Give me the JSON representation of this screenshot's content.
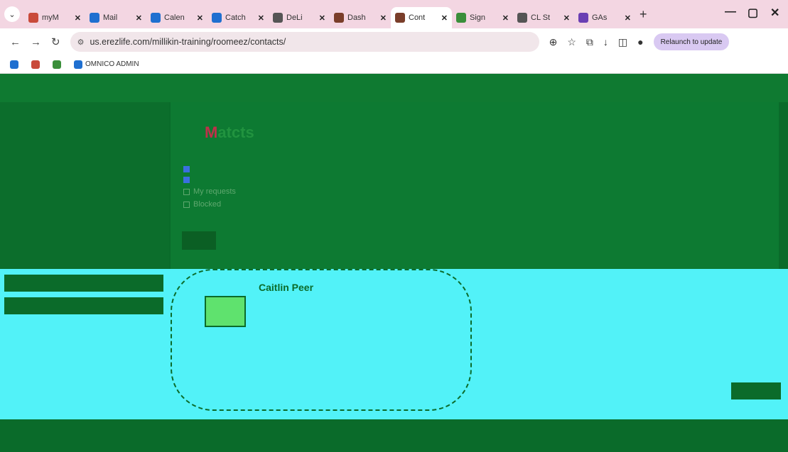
{
  "browser": {
    "tabs": [
      {
        "label": "myM",
        "color": "#c94a3a",
        "active": false
      },
      {
        "label": "Mail",
        "color": "#1f6fd0",
        "active": false
      },
      {
        "label": "Calen",
        "color": "#1f6fd0",
        "active": false
      },
      {
        "label": "Catch",
        "color": "#1f6fd0",
        "active": false
      },
      {
        "label": "DeLi",
        "color": "#555555",
        "active": false
      },
      {
        "label": "Dash",
        "color": "#7a3e2a",
        "active": false
      },
      {
        "label": "Cont",
        "color": "#7a3e2a",
        "active": true
      },
      {
        "label": "Sign",
        "color": "#3b8f3b",
        "active": false
      },
      {
        "label": "CL St",
        "color": "#555555",
        "active": false
      },
      {
        "label": "GAs",
        "color": "#6a3fb3",
        "active": false
      }
    ],
    "url": "us.erezlife.com/millikin-training/roomeez/contacts/",
    "profile": "Relaunch to update"
  },
  "bookmarks": [
    {
      "label": "",
      "color": "#1f6fd0"
    },
    {
      "label": "",
      "color": "#c94a3a"
    },
    {
      "label": "",
      "color": "#3b8f3b"
    },
    {
      "label": "OMNICO ADMIN",
      "color": "#1f6fd0"
    }
  ],
  "page": {
    "title_accent": "M",
    "title_rest": "atcts",
    "card_name": "Caitlin Peer"
  },
  "filters": [
    {
      "label": "",
      "checked": true
    },
    {
      "label": "",
      "checked": true
    },
    {
      "label": "My requests",
      "checked": false
    },
    {
      "label": "Blocked",
      "checked": false
    }
  ]
}
